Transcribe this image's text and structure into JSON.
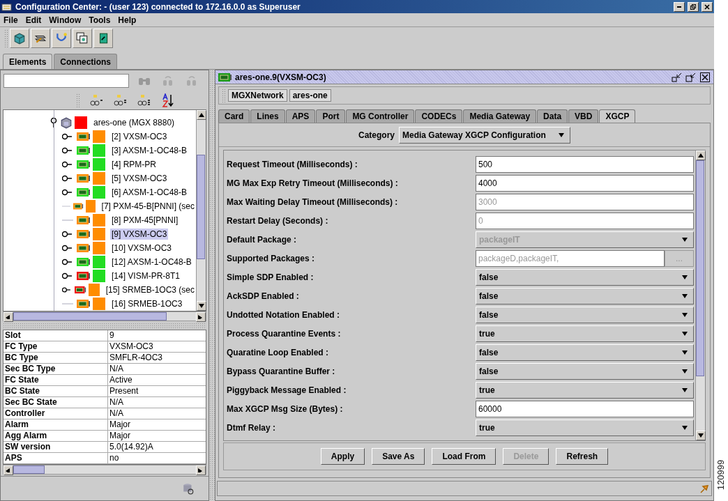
{
  "window": {
    "title": "Configuration Center: - (user 123) connected to 172.16.0.0 as Superuser"
  },
  "menu": [
    "File",
    "Edit",
    "Window",
    "Tools",
    "Help"
  ],
  "main_tabs": [
    {
      "label": "Elements",
      "selected": true
    },
    {
      "label": "Connections",
      "selected": false
    }
  ],
  "tree": {
    "node": {
      "label": "ares-one (MGX 8880)",
      "expanded": true,
      "color": "#ff0000"
    },
    "children": [
      {
        "label": "[2] VXSM-OC3",
        "expandable": true,
        "card": {
          "color": "#ff8c00"
        },
        "color": "#ff8c00",
        "selected": false
      },
      {
        "label": "[3] AXSM-1-OC48-B",
        "expandable": true,
        "card": {
          "color": "#22dd22"
        },
        "color": "#22dd22",
        "selected": false
      },
      {
        "label": "[4] RPM-PR",
        "expandable": true,
        "card": {
          "color": "#22dd22"
        },
        "color": "#22dd22",
        "selected": false
      },
      {
        "label": "[5] VXSM-OC3",
        "expandable": true,
        "card": {
          "color": "#ff8c00"
        },
        "color": "#ff8c00",
        "selected": false
      },
      {
        "label": "[6] AXSM-1-OC48-B",
        "expandable": true,
        "card": {
          "color": "#22dd22"
        },
        "color": "#22dd22",
        "selected": false
      },
      {
        "label": "[7] PXM-45-B[PNNI] (sec",
        "expandable": false,
        "card": {
          "color": "#ff8c00"
        },
        "color": "#ff8c00",
        "selected": false
      },
      {
        "label": "[8] PXM-45[PNNI]",
        "expandable": false,
        "card": {
          "color": "#ff8c00"
        },
        "color": "#ff8c00",
        "selected": false
      },
      {
        "label": "[9] VXSM-OC3",
        "expandable": true,
        "card": {
          "color": "#ff8c00"
        },
        "color": "#ff8c00",
        "selected": true
      },
      {
        "label": "[10] VXSM-OC3",
        "expandable": true,
        "card": {
          "color": "#ff8c00"
        },
        "color": "#ff8c00",
        "selected": false
      },
      {
        "label": "[12] AXSM-1-OC48-B",
        "expandable": true,
        "card": {
          "color": "#22dd22"
        },
        "color": "#22dd22",
        "selected": false
      },
      {
        "label": "[14] VISM-PR-8T1",
        "expandable": true,
        "card": {
          "color": "#ee1111"
        },
        "color": "#22dd22",
        "selected": false
      },
      {
        "label": "[15] SRMEB-1OC3 (sec",
        "expandable": true,
        "card": {
          "color": "#ee1111"
        },
        "color": "#ff8c00",
        "selected": false
      },
      {
        "label": "[16] SRMEB-1OC3",
        "expandable": false,
        "card": {
          "color": "#ff8c00"
        },
        "color": "#ff8c00",
        "selected": false
      }
    ]
  },
  "properties": [
    {
      "name": "Slot",
      "value": "9"
    },
    {
      "name": "FC Type",
      "value": "VXSM-OC3"
    },
    {
      "name": "BC Type",
      "value": "SMFLR-4OC3"
    },
    {
      "name": "Sec BC Type",
      "value": "N/A"
    },
    {
      "name": "FC State",
      "value": "Active"
    },
    {
      "name": "BC State",
      "value": "Present"
    },
    {
      "name": "Sec BC State",
      "value": "N/A"
    },
    {
      "name": "Controller",
      "value": "N/A"
    },
    {
      "name": "Alarm",
      "value": "Major"
    },
    {
      "name": "Agg Alarm",
      "value": "Major"
    },
    {
      "name": "SW version",
      "value": "5.0(14.92)A"
    },
    {
      "name": "APS",
      "value": "no"
    }
  ],
  "frame": {
    "title": "ares-one.9(VXSM-OC3)",
    "breadcrumb": [
      "MGXNetwork",
      "ares-one"
    ],
    "tabs": [
      {
        "label": "Card",
        "selected": false
      },
      {
        "label": "Lines",
        "selected": false
      },
      {
        "label": "APS",
        "selected": false
      },
      {
        "label": "Port",
        "selected": false
      },
      {
        "label": "MG Controller",
        "selected": false
      },
      {
        "label": "CODECs",
        "selected": false
      },
      {
        "label": "Media Gateway",
        "selected": false
      },
      {
        "label": "Data",
        "selected": false
      },
      {
        "label": "VBD",
        "selected": false
      },
      {
        "label": "XGCP",
        "selected": true
      }
    ],
    "category": {
      "label": "Category",
      "value": "Media Gateway XGCP Configuration"
    },
    "fields": [
      {
        "kind": "text",
        "label": "Request Timeout (Milliseconds) :",
        "value": "500",
        "disabled": false
      },
      {
        "kind": "text",
        "label": "MG Max Exp Retry Timeout (Milliseconds) :",
        "value": "4000",
        "disabled": false
      },
      {
        "kind": "text",
        "label": "Max Waiting Delay Timeout (Milliseconds) :",
        "value": "3000",
        "disabled": true
      },
      {
        "kind": "text",
        "label": "Restart Delay (Seconds) :",
        "value": "0",
        "disabled": true
      },
      {
        "kind": "select",
        "label": "Default Package :",
        "value": "packageIT",
        "disabled": true
      },
      {
        "kind": "browse",
        "label": "Supported Packages :",
        "value": "packageD,packageIT,",
        "button": "...",
        "disabled": true
      },
      {
        "kind": "select",
        "label": "Simple SDP Enabled :",
        "value": "false",
        "disabled": false
      },
      {
        "kind": "select",
        "label": "AckSDP Enabled :",
        "value": "false",
        "disabled": false
      },
      {
        "kind": "select",
        "label": "Undotted Notation Enabled :",
        "value": "false",
        "disabled": false
      },
      {
        "kind": "select",
        "label": "Process Quarantine Events :",
        "value": "true",
        "disabled": false
      },
      {
        "kind": "select",
        "label": "Quaratine Loop Enabled :",
        "value": "false",
        "disabled": false
      },
      {
        "kind": "select",
        "label": "Bypass Quarantine Buffer :",
        "value": "false",
        "disabled": false
      },
      {
        "kind": "select",
        "label": "Piggyback Message Enabled :",
        "value": "true",
        "disabled": false
      },
      {
        "kind": "text",
        "label": "Max XGCP Msg Size (Bytes) :",
        "value": "60000",
        "disabled": false
      },
      {
        "kind": "select",
        "label": "Dtmf Relay :",
        "value": "true",
        "disabled": false
      }
    ],
    "buttons": [
      {
        "label": "Apply",
        "disabled": false
      },
      {
        "label": "Save As",
        "disabled": false
      },
      {
        "label": "Load From",
        "disabled": false
      },
      {
        "label": "Delete",
        "disabled": true
      },
      {
        "label": "Refresh",
        "disabled": false
      }
    ]
  },
  "figure_number": "120999"
}
